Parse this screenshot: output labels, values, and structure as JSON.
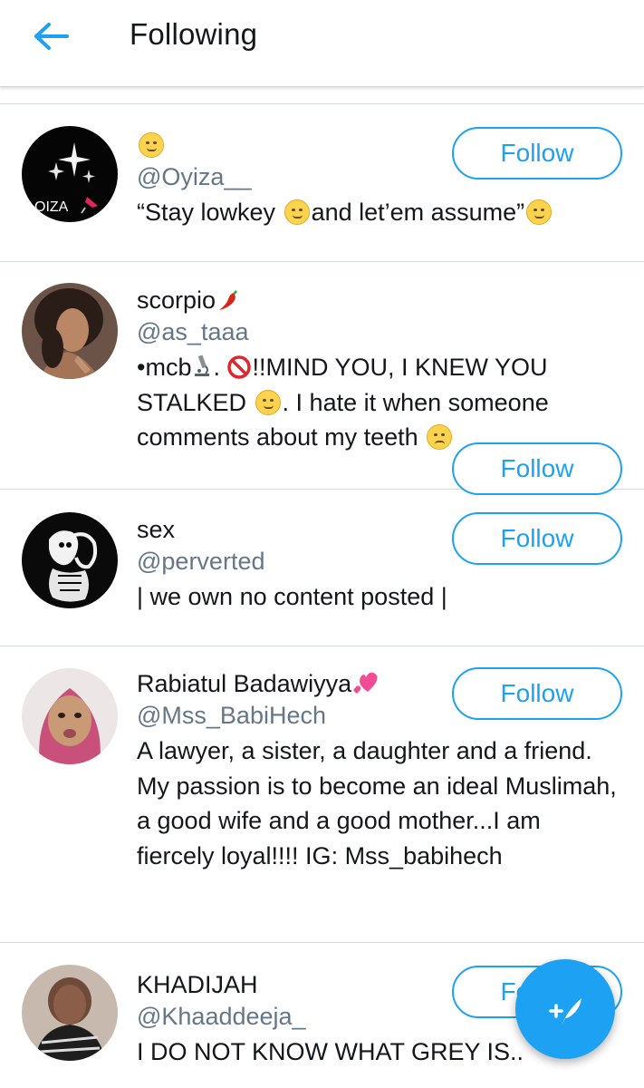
{
  "header": {
    "title": "Following",
    "back_icon": "arrow-left-icon"
  },
  "colors": {
    "accent": "#1da1f2",
    "handle_gray": "#657786",
    "text": "#14171a",
    "divider": "#d6dbdf"
  },
  "follow_label": "Follow",
  "users": [
    {
      "name": "",
      "name_emoji": "slightly-smiling-face",
      "handle": "@Oyiza__",
      "bio_a": "“Stay lowkey ",
      "bio_b": "and let’em assume”",
      "avatar_text": "OIZA"
    },
    {
      "name": "scorpio",
      "name_emoji": "chili-pepper",
      "handle": "@as_taaa",
      "bio_a": "•mcb",
      "bio_b": ". ",
      "bio_c": "!!MIND YOU, I KNEW YOU STALKED ",
      "bio_d": ". I hate it when someone comments about my teeth "
    },
    {
      "name": "sex",
      "handle": "@perverted",
      "bio": "| we own no content posted |"
    },
    {
      "name": "Rabiatul Badawiyya",
      "name_emoji": "two-hearts",
      "handle": "@Mss_BabiHech",
      "bio": "A lawyer, a sister, a daughter and a friend. My passion is to become an ideal Muslimah, a good wife and a good mother...I am fiercely loyal!!!! IG: Mss_babihech"
    },
    {
      "name": "KHADIJAH",
      "handle": "@Khaaddeeja_",
      "bio": "I DO NOT KNOW WHAT GREY IS.."
    }
  ],
  "fab": {
    "icon": "compose-tweet-icon"
  }
}
